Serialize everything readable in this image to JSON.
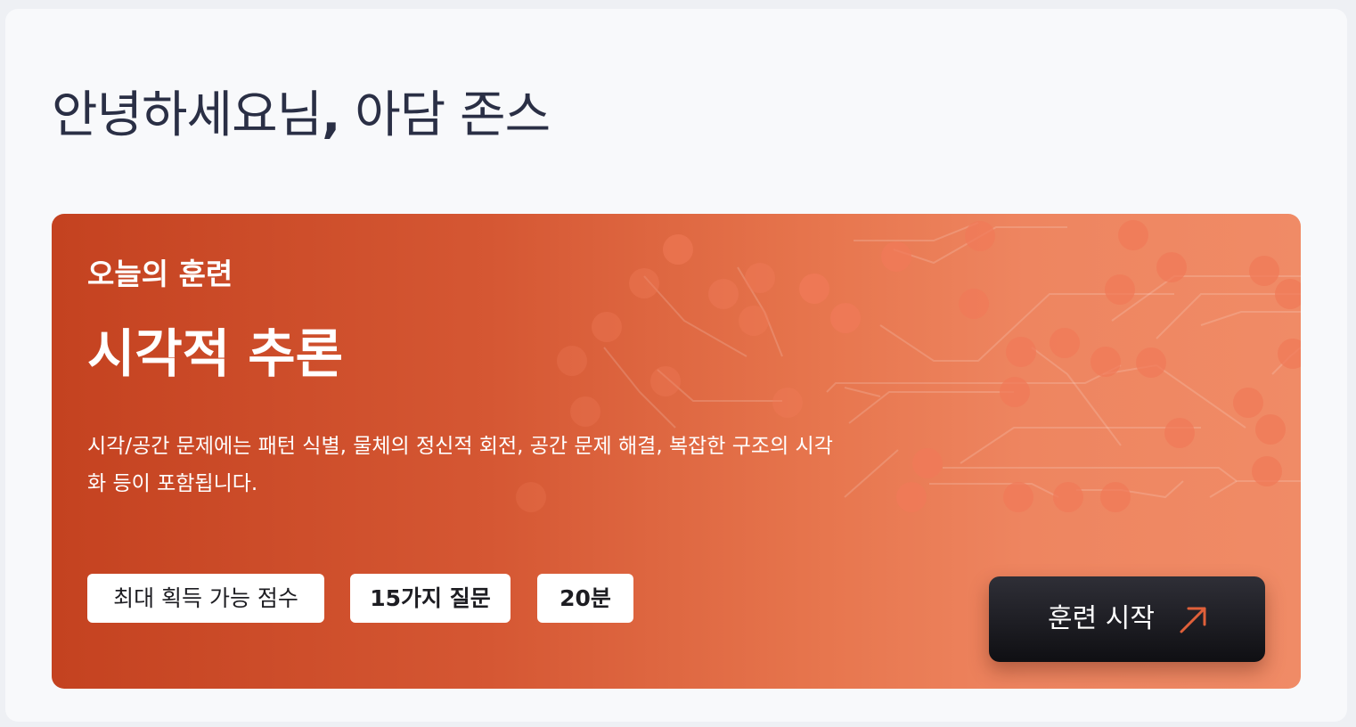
{
  "greeting": {
    "text": "안녕하세요님",
    "comma": ",",
    "name": " 아담 존스"
  },
  "training_card": {
    "eyebrow": "오늘의 훈련",
    "title": "시각적 추론",
    "description": "시각/공간 문제에는 패턴 식별, 물체의 정신적 회전, 공간 문제 해결, 복잡한 구조의 시각화 등이 포함됩니다.",
    "chips": {
      "points": "최대 획득 가능 점수",
      "questions": "15가지 질문",
      "duration": "20분"
    },
    "start_button": {
      "label": "훈련 시작",
      "icon": "arrow-up-right-icon"
    },
    "colors": {
      "gradient_start": "#c44220",
      "gradient_end": "#f08b66",
      "arrow_accent": "#e0603a",
      "button_bg": "#1a1a20"
    }
  }
}
